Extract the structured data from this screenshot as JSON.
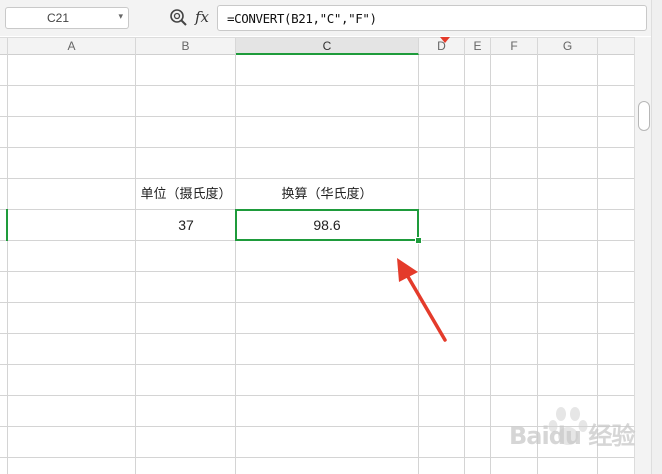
{
  "formula_bar": {
    "name_box": "C21",
    "zoom_icon": "zoom-icon",
    "fx_label": "fx",
    "formula": "=CONVERT(B21,\"C\",\"F\")"
  },
  "columns": [
    {
      "label": "A"
    },
    {
      "label": "B"
    },
    {
      "label": "C"
    },
    {
      "label": "D"
    },
    {
      "label": "E"
    },
    {
      "label": "F"
    },
    {
      "label": "G"
    }
  ],
  "cells": {
    "b_header": "单位（摄氏度）",
    "c_header": "换算（华氏度）",
    "b_value": "37",
    "c_value": "98.6"
  },
  "selected_cell": "C21",
  "colors": {
    "selection": "#1e9b3b",
    "annotation_arrow": "#e43b2b"
  },
  "watermark": {
    "logo_text": "Baidu 经验"
  }
}
